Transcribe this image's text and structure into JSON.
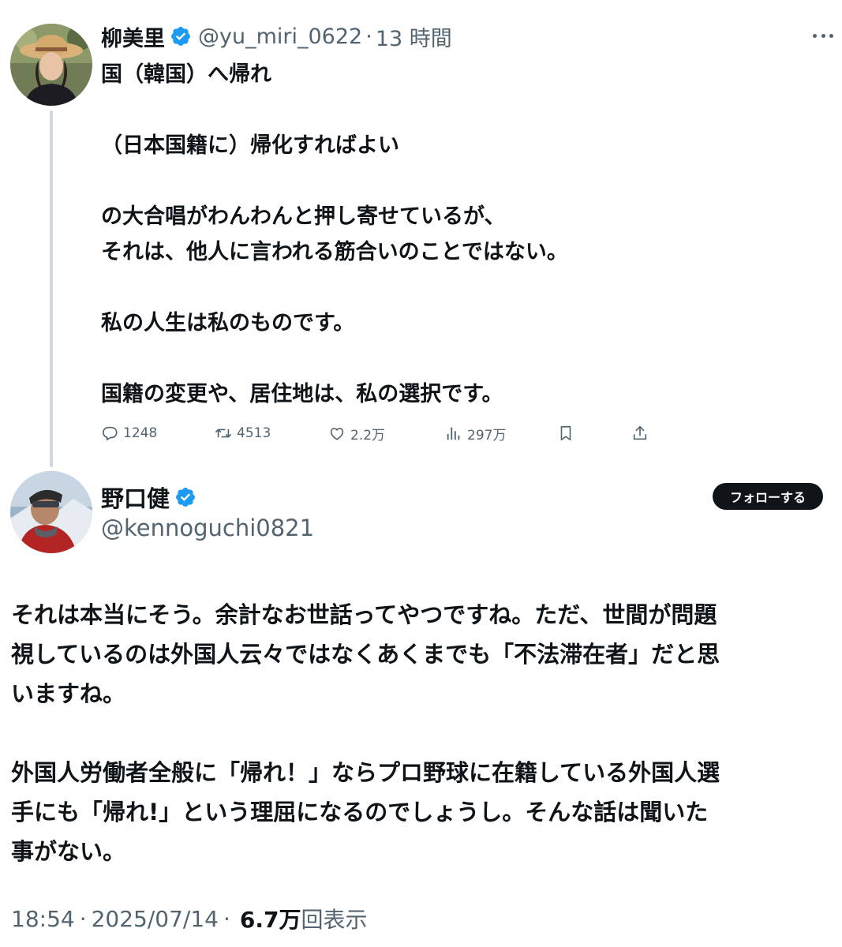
{
  "parent_tweet": {
    "author_name": "柳美里",
    "handle": "@yu_miri_0622",
    "separator": "·",
    "time_ago": "13 時間",
    "lines": [
      "国（韓国）へ帰れ",
      "",
      "（日本国籍に）帰化すればよい",
      "",
      "の大合唱がわんわんと押し寄せているが、",
      "それは、他人に言われる筋合いのことではない。",
      "",
      "私の人生は私のものです。",
      "",
      "国籍の変更や、居住地は、私の選択です。"
    ],
    "stats": {
      "replies": "1248",
      "retweets": "4513",
      "likes": "2.2万",
      "views": "297万"
    }
  },
  "main_tweet": {
    "author_name": "野口健",
    "handle": "@kennoguchi0821",
    "follow_label": "フォローする",
    "lines": [
      "それは本当にそう。余計なお世話ってやつですね。ただ、世間が問題",
      "視しているのは外国人云々ではなくあくまでも「不法滞在者」だと思",
      "いますね。",
      "",
      "外国人労働者全般に「帰れ！」ならプロ野球に在籍している外国人選",
      "手にも「帰れ!」という理屈になるのでしょうし。そんな話は聞いた",
      "事がない。"
    ],
    "time": "18:54",
    "date": "2025/07/14",
    "meta_separator": "·",
    "view_count": "6.7万",
    "view_label": "回表示"
  },
  "colors": {
    "verified_blue": "#1d9bf0",
    "text_primary": "#0f1419",
    "text_secondary": "#536471",
    "thread_line": "#cfd9de"
  },
  "icons": [
    "verified-badge-icon",
    "more-icon",
    "reply-icon",
    "retweet-icon",
    "like-icon",
    "views-icon",
    "bookmark-icon",
    "share-icon"
  ]
}
